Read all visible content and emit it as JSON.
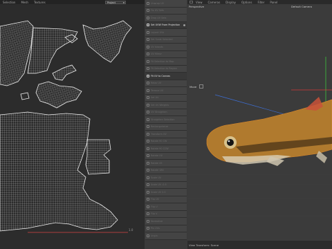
{
  "uv_editor": {
    "menu": [
      "Selection",
      "Mesh",
      "Textures"
    ],
    "project_select": "Project",
    "version_label": "1.0"
  },
  "tools": [
    {
      "label": "Unwrap UV",
      "enabled": false
    },
    {
      "label": "Fix UV Sets",
      "enabled": false
    },
    {
      "label": "Drop UV Sets",
      "enabled": false
    },
    {
      "label": "Set UVW From Projection",
      "enabled": true
    },
    {
      "label": "Layout UVs",
      "enabled": false
    },
    {
      "label": "Set Scale Selected",
      "enabled": false
    },
    {
      "label": "UV Islands",
      "enabled": false
    },
    {
      "label": "UV Mirror",
      "enabled": false
    },
    {
      "label": "Fit Selection to Map",
      "enabled": false
    },
    {
      "label": "Fit Selection to Region",
      "enabled": false
    },
    {
      "label": "Fit UV to Canvas",
      "enabled": true
    },
    {
      "label": "Relax UV",
      "enabled": false
    },
    {
      "label": "Terrace UV",
      "enabled": false
    },
    {
      "label": "Set UV",
      "enabled": false
    },
    {
      "label": "Set UV Weights",
      "enabled": false
    },
    {
      "label": "UV Straighten",
      "enabled": false
    },
    {
      "label": "Straighten Selection",
      "enabled": false
    },
    {
      "label": "Rectangularize",
      "enabled": false
    },
    {
      "label": "Transform UV",
      "enabled": false
    },
    {
      "label": "Rotate 90 CW",
      "enabled": false
    },
    {
      "label": "Rotate 90 CCW",
      "enabled": false
    },
    {
      "label": "Rotate UV",
      "enabled": false
    },
    {
      "label": "Rotate 45",
      "enabled": false
    },
    {
      "label": "Rotate 180",
      "enabled": false
    },
    {
      "label": "Scale UV",
      "enabled": false
    },
    {
      "label": "Scale UV -0.5",
      "enabled": false
    },
    {
      "label": "Scale UV 2.0",
      "enabled": false
    },
    {
      "label": "Flip UV",
      "enabled": false
    },
    {
      "label": "Flip U",
      "enabled": false
    },
    {
      "label": "Flip V",
      "enabled": false
    },
    {
      "label": "Normalize",
      "enabled": false
    },
    {
      "label": "Pin UVs",
      "enabled": false
    },
    {
      "label": "Unpin",
      "enabled": false
    }
  ],
  "viewport": {
    "menu": [
      "View",
      "Cameras",
      "Display",
      "Options",
      "Filter",
      "Panel"
    ],
    "title": "Perspective",
    "camera": "Default Camera",
    "move_label": "Move",
    "status": "View Transform: Scene"
  },
  "colors": {
    "uv_wire": "#e8e8e8",
    "uv_background": "#2c2c2c",
    "viewport_background": "#3b3b3b",
    "fish_body": "#b07a2e",
    "axis_green": "#3cc53c",
    "axis_blue": "#3d6fd6",
    "axis_red": "#d63b3b"
  }
}
